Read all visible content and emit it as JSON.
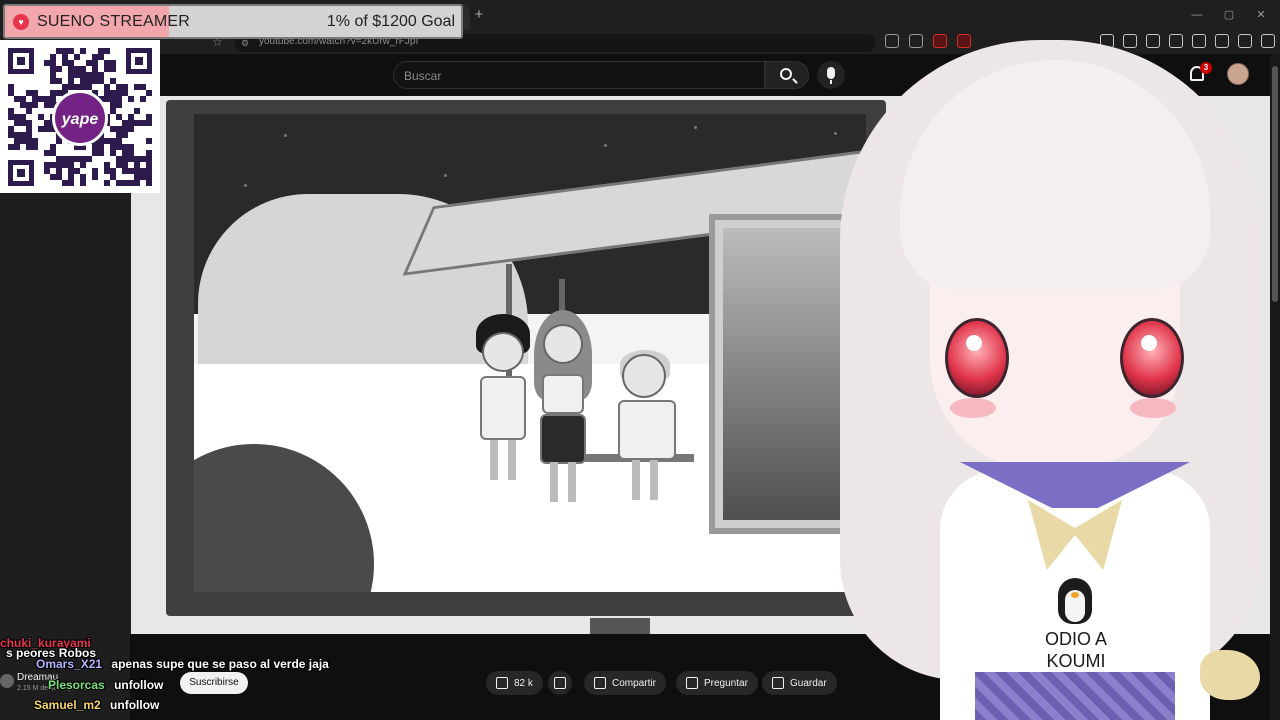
{
  "goal": {
    "title": "SUENO STREAMER",
    "amount": "1% of $1200 Goal",
    "progress": 0.36
  },
  "browser": {
    "url": "youtube.com/watch?v=2kUrw_rFJpI"
  },
  "youtube": {
    "search_placeholder": "Buscar",
    "notification_count": "3",
    "channel_name": "Dreamau",
    "channel_subs": "2.15 M de suscriptores",
    "subscribe_label": "Suscribirse",
    "likes": "82 k",
    "share_label": "Compartir",
    "ask_label": "Preguntar",
    "save_label": "Guardar"
  },
  "qr": {
    "brand": "yape"
  },
  "vtuber": {
    "shirt_text_line1": "ODIO A",
    "shirt_text_line2": "KOUMI"
  },
  "chat": [
    {
      "user": "chuki_kurayami",
      "message": "",
      "color": "#e8344d"
    },
    {
      "user": "",
      "message": "s peores Robos",
      "color": "#ffffff"
    },
    {
      "user": "Omars_X21",
      "message": "apenas supe que se paso al verde jaja",
      "color": "#b4b4ff"
    },
    {
      "user": "Plesorcas",
      "message": "unfollow",
      "color": "#7be37b"
    },
    {
      "user": "Samuel_m2",
      "message": "unfollow",
      "color": "#f5d56a"
    }
  ],
  "colors": {
    "goal_fill": "#f2a7ad",
    "youtube_red": "#cc0000",
    "yape_purple": "#742384"
  }
}
